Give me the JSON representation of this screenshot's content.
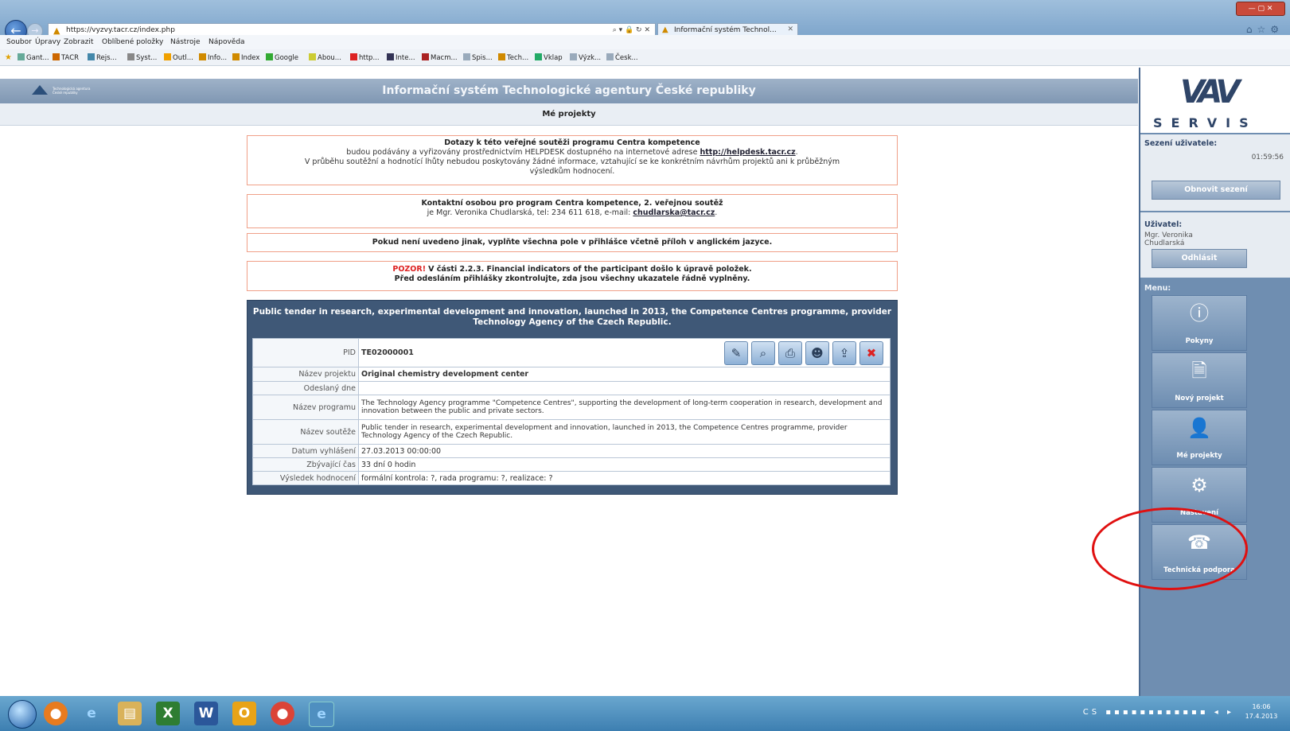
{
  "browser": {
    "url": "https://vyzvy.tacr.cz/index.php",
    "address_icons": "⌕ ▾ 🔒 ↻ ✕",
    "tab_title": "Informační systém Technol...",
    "menu": [
      "Soubor",
      "Úpravy",
      "Zobrazit",
      "Oblíbené položky",
      "Nástroje",
      "Nápověda"
    ],
    "favorites": [
      "Gant...",
      "TACR",
      "Rejs...",
      "Syst...",
      "Outl...",
      "Info...",
      "Index",
      "Google",
      "Abou...",
      "http...",
      "Inte...",
      "Macm...",
      "Spis...",
      "Tech...",
      "Vklap",
      "Výzk...",
      "Česk..."
    ]
  },
  "page": {
    "title": "Informační systém Technologické agentury České republiky",
    "subtitle": "Mé projekty",
    "logo_text": "Technologická agentura České republiky"
  },
  "notices": {
    "n1_title": "Dotazy k této veřejné soutěži programu Centra kompetence",
    "n1_line1": "budou podávány a vyřizovány prostřednictvím HELPDESK dostupného na internetové adrese",
    "n1_link": "http://helpdesk.tacr.cz",
    "n1_line2": "V průběhu soutěžní a hodnotící lhůty nebudou poskytovány žádné informace, vztahující se ke konkrétním návrhům projektů ani k průběžným",
    "n1_line3": "výsledkům hodnocení.",
    "n2_title": "Kontaktní osobou pro program Centra kompetence, 2. veřejnou soutěž",
    "n2_line": "je Mgr. Veronika Chudlarská, tel: 234 611 618, e-mail:",
    "n2_email": "chudlarska@tacr.cz",
    "n3_text": "Pokud není uvedeno jinak, vyplňte všechna pole v přihlášce včetně příloh v anglickém jazyce.",
    "n4_alert": "POZOR!",
    "n4_line1": "V části 2.2.3. Financial indicators of the participant došlo k úpravě položek.",
    "n4_line2": "Před odesláním přihlášky zkontrolujte, zda jsou všechny ukazatele řádně vyplněny."
  },
  "project": {
    "header": "Public tender in research, experimental development and innovation, launched in 2013, the Competence Centres programme, provider Technology Agency of the Czech Republic.",
    "rows": [
      {
        "label": "PID",
        "value": "TE02000001"
      },
      {
        "label": "Název projektu",
        "value": "Original chemistry development center"
      },
      {
        "label": "Odeslaný dne",
        "value": ""
      },
      {
        "label": "Název programu",
        "value": "The Technology Agency programme \"Competence Centres\", supporting the development of long-term cooperation in research, development and innovation between the public and private sectors."
      },
      {
        "label": "Název soutěže",
        "value": "Public tender in research, experimental development and innovation, launched in 2013, the Competence Centres programme, provider Technology Agency of the Czech Republic."
      },
      {
        "label": "Datum vyhlášení",
        "value": "27.03.2013 00:00:00"
      },
      {
        "label": "Zbývající čas",
        "value": "33 dní 0 hodin"
      },
      {
        "label": "Výsledek hodnocení",
        "value": "formální kontrola: ?, rada programu: ?, realizace: ?"
      }
    ],
    "action_icons": [
      "edit-icon",
      "search-icon",
      "print-icon",
      "users-icon",
      "upload-icon",
      "delete-icon"
    ]
  },
  "sidebar": {
    "brand": "SERVIS",
    "session_label": "Sezení uživatele:",
    "session_time": "01:59:56",
    "renew_button": "Obnovit sezení",
    "user_label": "Uživatel:",
    "user_name": "Mgr. Veronika Chudlarská",
    "logout_button": "Odhlásit",
    "menu_label": "Menu:",
    "tiles": [
      {
        "label": "Pokyny",
        "icon": "info-icon"
      },
      {
        "label": "Nový projekt",
        "icon": "new-document-icon"
      },
      {
        "label": "Mé projekty",
        "icon": "person-icon"
      },
      {
        "label": "Nastavení",
        "icon": "gear-icon"
      },
      {
        "label": "Technická podpora",
        "icon": "support-icon"
      }
    ]
  },
  "taskbar": {
    "clock_time": "16:06",
    "clock_date": "17.4.2013",
    "tray_lang": "CS"
  },
  "colors": {
    "header": "#7f97b3",
    "project_box": "#3f5877",
    "sidebar": "#6f8eb1",
    "notice_border": "#f0a088",
    "alert": "#dd2222",
    "highlight": "#e01010"
  }
}
